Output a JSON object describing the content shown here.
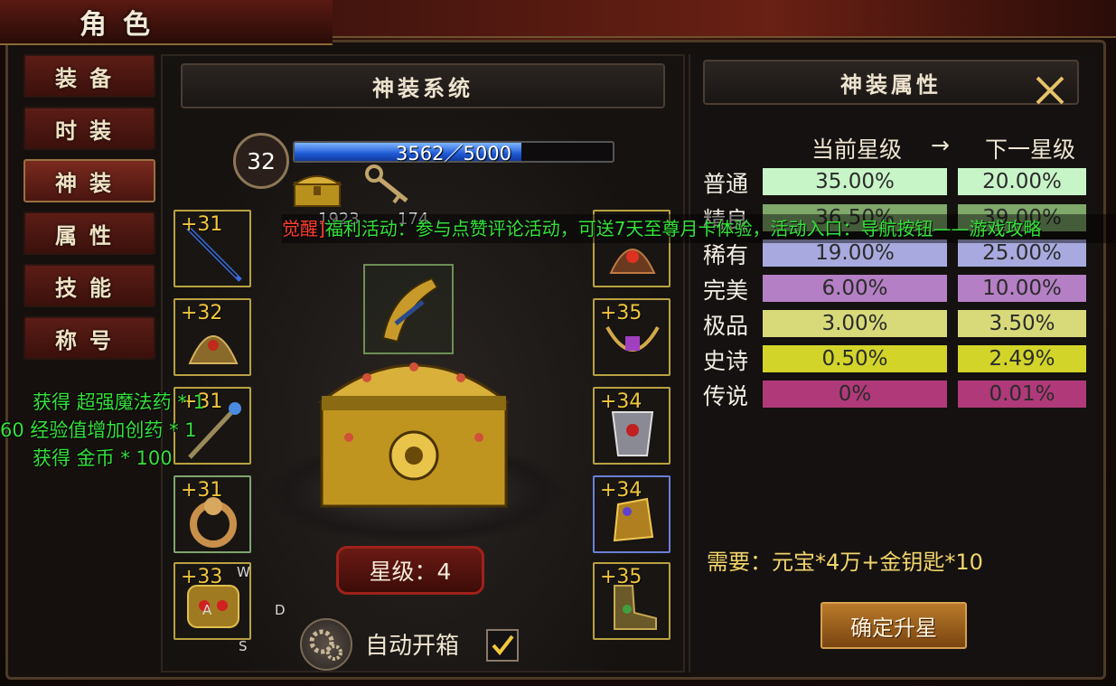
{
  "window": {
    "title": "角色"
  },
  "nav": {
    "items": [
      {
        "label": "装备"
      },
      {
        "label": "时装"
      },
      {
        "label": "神装"
      },
      {
        "label": "属性"
      },
      {
        "label": "技能"
      },
      {
        "label": "称号"
      }
    ],
    "active_index": 2
  },
  "chat_log": [
    "获得 超强魔法药 * 1",
    "60 经验值增加创药 * 1",
    "获得 金币 * 100"
  ],
  "center": {
    "header": "神装系统",
    "level": "32",
    "exp_text": "3562／5000",
    "exp_fraction": 0.7124,
    "chest_count": "1923",
    "key_count": "174",
    "left_slots": [
      {
        "plus": "+31",
        "icon": "sword-icon"
      },
      {
        "plus": "+32",
        "icon": "dragon-helm-icon"
      },
      {
        "plus": "+31",
        "icon": "staff-icon"
      },
      {
        "plus": "+31",
        "icon": "dragon-ring-icon"
      },
      {
        "plus": "+33",
        "icon": "demon-mask-icon"
      }
    ],
    "right_slots": [
      {
        "plus": "",
        "icon": "demon-helm-icon"
      },
      {
        "plus": "+35",
        "icon": "necklace-icon"
      },
      {
        "plus": "+34",
        "icon": "armor-icon"
      },
      {
        "plus": "+34",
        "icon": "gauntlet-icon"
      },
      {
        "plus": "+35",
        "icon": "boots-icon"
      }
    ],
    "star_label": "星级：4",
    "auto_open_label": "自动开箱",
    "auto_open_checked": true,
    "wasd": {
      "w": "W",
      "a": "A",
      "s": "S",
      "d": "D"
    }
  },
  "broadcast": {
    "tag": "觉醒]",
    "text": "福利活动：参与点赞评论活动，可送7天至尊月卡体验，活动入口：导航按钮——游戏攻略"
  },
  "attributes": {
    "header": "神装属性",
    "col_current": "当前星级",
    "arrow": "→",
    "col_next": "下一星级",
    "rows": [
      {
        "label": "普通",
        "current": "35.00%",
        "next": "20.00%",
        "color": "#c8f5c8"
      },
      {
        "label": "精良",
        "current": "36.50%",
        "next": "39.00%",
        "color": "#7fa86a"
      },
      {
        "label": "稀有",
        "current": "19.00%",
        "next": "25.00%",
        "color": "#a8aadf"
      },
      {
        "label": "完美",
        "current": "6.00%",
        "next": "10.00%",
        "color": "#b57fc5"
      },
      {
        "label": "极品",
        "current": "3.00%",
        "next": "3.50%",
        "color": "#d8da7a"
      },
      {
        "label": "史诗",
        "current": "0.50%",
        "next": "2.49%",
        "color": "#d2d42a"
      },
      {
        "label": "传说",
        "current": "0%",
        "next": "0.01%",
        "color": "#b0397a"
      }
    ],
    "requirement": "需要：元宝*4万+金钥匙*10",
    "confirm_label": "确定升星"
  }
}
